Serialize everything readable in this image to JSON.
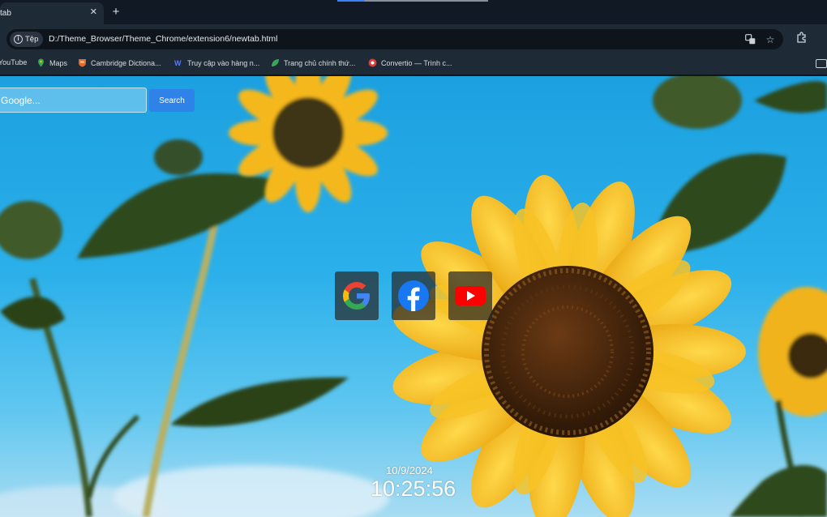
{
  "tab": {
    "title": "tab",
    "close_label": "✕"
  },
  "toolbar": {
    "chip_label": "Tệp",
    "url": "D:/Theme_Browser/Theme_Chrome/extension6/newtab.html"
  },
  "bookmarks": [
    {
      "label": "YouTube",
      "color": "#ff0000"
    },
    {
      "label": "Maps",
      "color": "#34a853"
    },
    {
      "label": "Cambridge Dictiona...",
      "color": "#e06a2b"
    },
    {
      "label": "Truy cập vào hàng n...",
      "color": "#5b7cf0"
    },
    {
      "label": "Trang chủ chính thứ...",
      "color": "#3aa757"
    },
    {
      "label": "Convertio — Trình c...",
      "color": "#e53935"
    }
  ],
  "search": {
    "placeholder": "Google...",
    "button_label": "Search"
  },
  "shortcuts": [
    {
      "name": "google",
      "icon": "google-icon"
    },
    {
      "name": "facebook",
      "icon": "facebook-icon"
    },
    {
      "name": "youtube",
      "icon": "youtube-icon"
    }
  ],
  "clock": {
    "date": "10/9/2024",
    "time": "10:25:56"
  },
  "colors": {
    "accent": "#2f82e8",
    "chrome_bg": "#1e2a36"
  }
}
